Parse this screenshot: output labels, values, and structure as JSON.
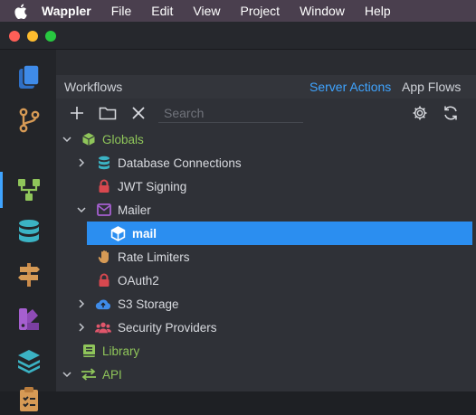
{
  "menubar": {
    "app_name": "Wappler",
    "items": [
      "File",
      "Edit",
      "View",
      "Project",
      "Window",
      "Help"
    ]
  },
  "panel": {
    "title": "Workflows",
    "tabs": [
      {
        "label": "Server Actions",
        "active": true
      },
      {
        "label": "App Flows",
        "active": false
      }
    ],
    "search_placeholder": "Search"
  },
  "tree": [
    {
      "label": "Globals",
      "icon": "cube-icon",
      "expanded": true,
      "color": "#8fc55a"
    },
    {
      "label": "Database Connections",
      "icon": "database-icon",
      "expanded": false
    },
    {
      "label": "JWT Signing",
      "icon": "lock-icon"
    },
    {
      "label": "Mailer",
      "icon": "envelope-icon",
      "expanded": true
    },
    {
      "label": "mail",
      "icon": "cube-icon",
      "selected": true
    },
    {
      "label": "Rate Limiters",
      "icon": "hand-icon"
    },
    {
      "label": "OAuth2",
      "icon": "lock-icon"
    },
    {
      "label": "S3 Storage",
      "icon": "cloud-upload-icon",
      "expanded": false
    },
    {
      "label": "Security Providers",
      "icon": "users-icon",
      "expanded": false
    },
    {
      "label": "Library",
      "icon": "book-icon",
      "color": "#8fc55a"
    },
    {
      "label": "API",
      "icon": "arrows-exchange-icon",
      "expanded": true,
      "color": "#8fc55a"
    }
  ],
  "colors": {
    "accent": "#3fa4ff",
    "selected_row": "#2b8ef0",
    "global_green": "#8fc55a",
    "lock_red": "#d8484f",
    "menubar": "#4a3f4e"
  }
}
